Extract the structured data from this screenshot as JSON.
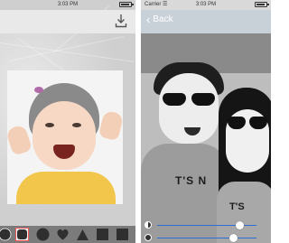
{
  "left_screen": {
    "status": {
      "time": "3:03 PM",
      "battery_level": 0.9
    },
    "toolbar": {
      "download_icon": "download-icon"
    },
    "tools": [
      {
        "icon": "circle-shape-icon"
      },
      {
        "icon": "rounded-square-shape-icon",
        "selected": true
      },
      {
        "icon": "circle-shape-icon"
      },
      {
        "icon": "heart-shape-icon"
      },
      {
        "icon": "triangle-shape-icon"
      },
      {
        "icon": "square-shape-icon"
      }
    ]
  },
  "right_screen": {
    "status": {
      "carrier": "Carrier",
      "time": "3:03 PM",
      "battery_level": 0.9
    },
    "nav": {
      "back_label": "Back"
    },
    "sliders": [
      {
        "icon": "contrast-icon",
        "value": 0.83
      },
      {
        "icon": "brightness-icon",
        "value": 0.77
      }
    ]
  },
  "colors": {
    "ios_blue": "#2b6fd6",
    "selected_outline": "#e55555"
  }
}
